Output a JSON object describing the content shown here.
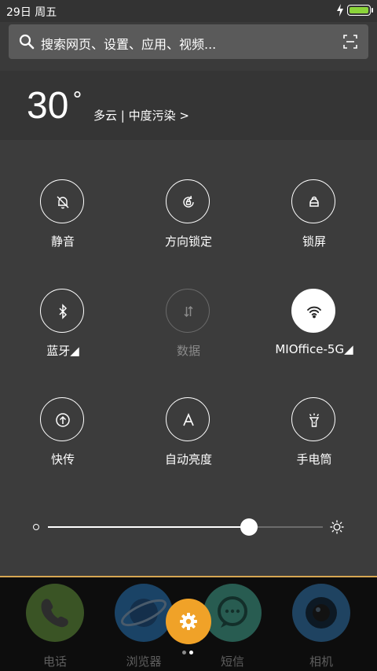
{
  "status_bar": {
    "date": "29日",
    "weekday": "周五",
    "battery_color": "#8bd43a"
  },
  "search": {
    "placeholder": "搜索网页、设置、应用、视频..."
  },
  "weather": {
    "temperature": "30",
    "degree_symbol": "°",
    "description": "多云 | 中度污染 >"
  },
  "toggles": [
    {
      "label": "静音",
      "icon": "bell-off-icon",
      "state": "off"
    },
    {
      "label": "方向锁定",
      "icon": "rotation-lock-icon",
      "state": "off"
    },
    {
      "label": "锁屏",
      "icon": "lock-icon",
      "state": "off"
    },
    {
      "label": "蓝牙◢",
      "icon": "bluetooth-icon",
      "state": "off"
    },
    {
      "label": "数据",
      "icon": "mobile-data-icon",
      "state": "disabled"
    },
    {
      "label": "MIOffice-5G◢",
      "icon": "wifi-icon",
      "state": "on"
    },
    {
      "label": "快传",
      "icon": "quick-transfer-icon",
      "state": "off"
    },
    {
      "label": "自动亮度",
      "icon": "auto-brightness-icon",
      "state": "off"
    },
    {
      "label": "手电筒",
      "icon": "flashlight-icon",
      "state": "off"
    }
  ],
  "brightness": {
    "level": 0.73
  },
  "dock": {
    "apps": [
      {
        "label": "电话",
        "icon": "phone-icon",
        "color": "#7ab648"
      },
      {
        "label": "浏览器",
        "icon": "browser-icon",
        "color": "#2c8ee0"
      },
      {
        "label": "短信",
        "icon": "message-icon",
        "color": "#4ec9b0"
      },
      {
        "label": "相机",
        "icon": "camera-icon",
        "color": "#3a8fd6"
      }
    ],
    "page_count": 2,
    "current_page": 2
  },
  "colors": {
    "accent": "#f0a228",
    "panel_edge": "#d6a652"
  }
}
